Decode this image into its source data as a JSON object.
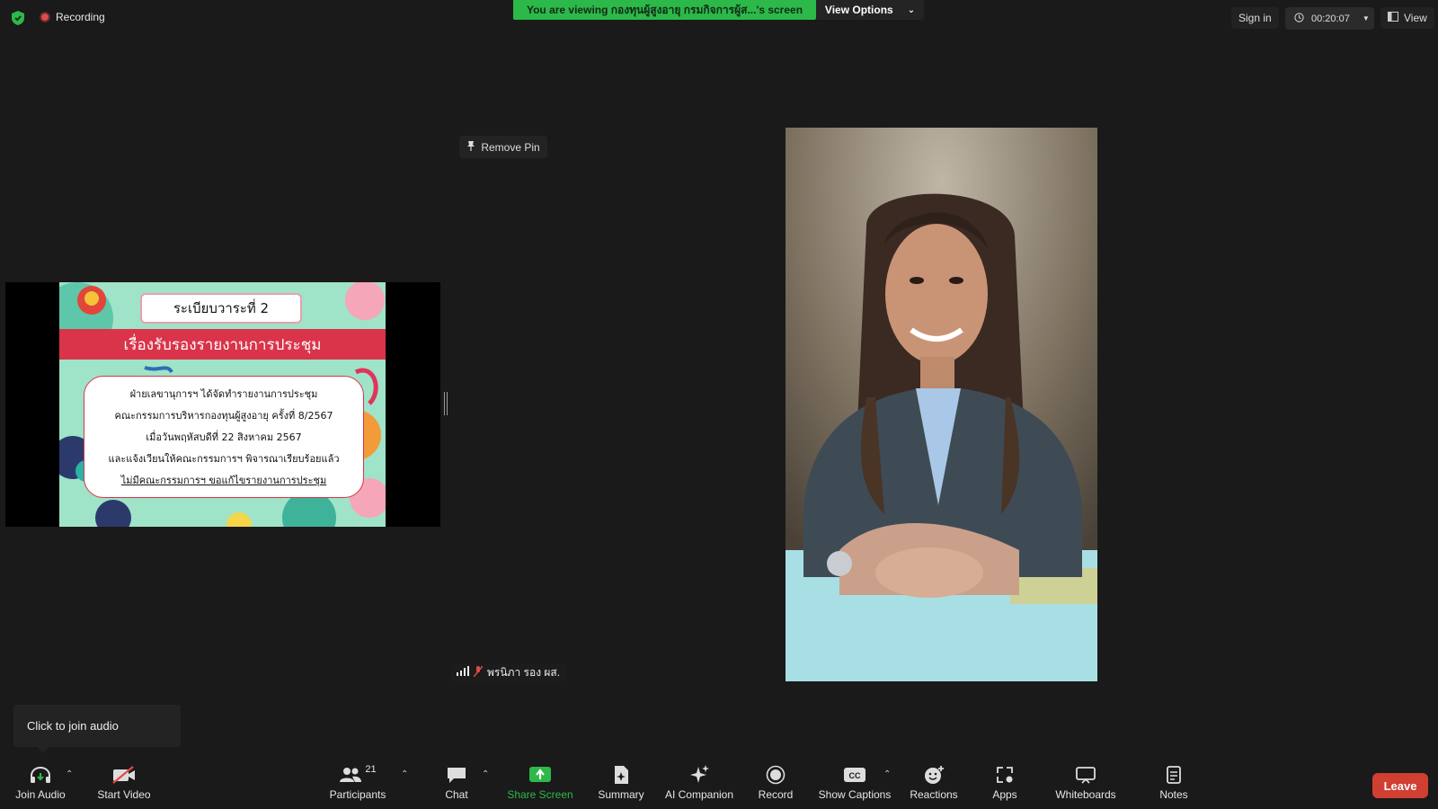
{
  "top": {
    "recording_label": "Recording",
    "viewing_banner": "You are viewing กองทุนผู้สูงอายุ กรมกิจการผู้ส...'s screen",
    "view_options": "View Options",
    "sign_in": "Sign in",
    "timer": "00:20:07",
    "view": "View"
  },
  "share": {
    "remove_pin": "Remove Pin",
    "slide": {
      "agenda": "ระเบียบวาระที่ 2",
      "heading": "เรื่องรับรองรายงานการประชุม",
      "lines": [
        "ฝ่ายเลขานุการฯ ได้จัดทำรายงานการประชุม",
        "คณะกรรมการบริหารกองทุนผู้สูงอายุ ครั้งที่ 8/2567",
        "เมื่อวันพฤหัสบดีที่ 22 สิงหาคม 2567",
        "และแจ้งเวียนให้คณะกรรมการฯ พิจารณาเรียบร้อยแล้ว",
        "ไม่มีคณะกรรมการฯ ขอแก้ไขรายงานการประชุม"
      ]
    },
    "participant_name": "พรนิภา รอง ผส."
  },
  "tooltip": "Click to join audio",
  "toolbar": {
    "join_audio": "Join Audio",
    "start_video": "Start Video",
    "participants": "Participants",
    "participants_count": "21",
    "chat": "Chat",
    "share_screen": "Share Screen",
    "summary": "Summary",
    "ai_companion": "AI Companion",
    "record": "Record",
    "show_captions": "Show Captions",
    "reactions": "Reactions",
    "apps": "Apps",
    "whiteboards": "Whiteboards",
    "notes": "Notes",
    "leave": "Leave"
  },
  "colors": {
    "banner_green": "#2db84a",
    "leave_red": "#d13e32",
    "share_green": "#2db84a",
    "slide_red": "#d9344a"
  }
}
